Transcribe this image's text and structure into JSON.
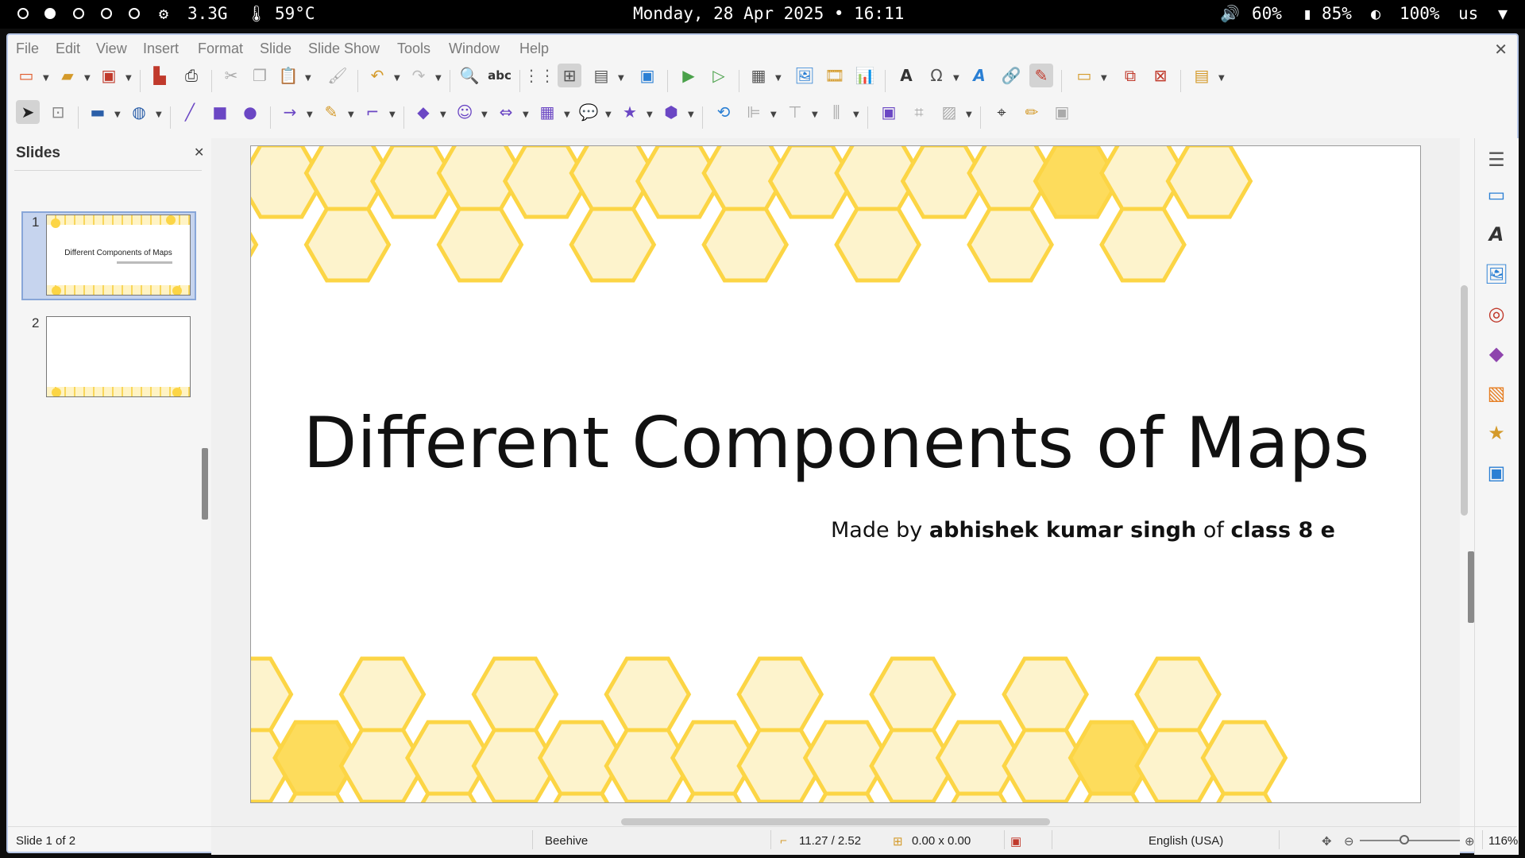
{
  "system_bar": {
    "cpu_freq": "3.3G",
    "temperature": "59°C",
    "datetime": "Monday, 28 Apr 2025 • 16:11",
    "volume": "60%",
    "battery": "85%",
    "brightness": "100%",
    "keyboard_layout": "us",
    "workspaces": [
      {
        "active": false
      },
      {
        "active": true
      },
      {
        "active": false
      },
      {
        "active": false
      },
      {
        "active": false
      }
    ]
  },
  "menubar": {
    "items": [
      "File",
      "Edit",
      "View",
      "Insert",
      "Format",
      "Slide",
      "Slide Show",
      "Tools",
      "Window",
      "Help"
    ]
  },
  "slides_pane": {
    "title": "Slides",
    "thumbnails": [
      {
        "number": "1",
        "title": "Different Components of Maps",
        "selected": true
      },
      {
        "number": "2",
        "title": "",
        "selected": false
      }
    ]
  },
  "slide": {
    "title": "Different Components of Maps",
    "subtitle_parts": {
      "made_by": "Made by",
      "author": "abhishek kumar singh",
      "of": "of",
      "class": "class 8 e"
    },
    "colors": {
      "hex_fill": "#fdf3cc",
      "hex_stroke": "#fcd545",
      "hex_solid": "#fddc5c"
    }
  },
  "statusbar": {
    "slide_position": "Slide 1 of 2",
    "master_slide": "Beehive",
    "cursor_position": "11.27 / 2.52",
    "object_size": "0.00 x 0.00",
    "language": "English (USA)",
    "zoom": "116%"
  }
}
